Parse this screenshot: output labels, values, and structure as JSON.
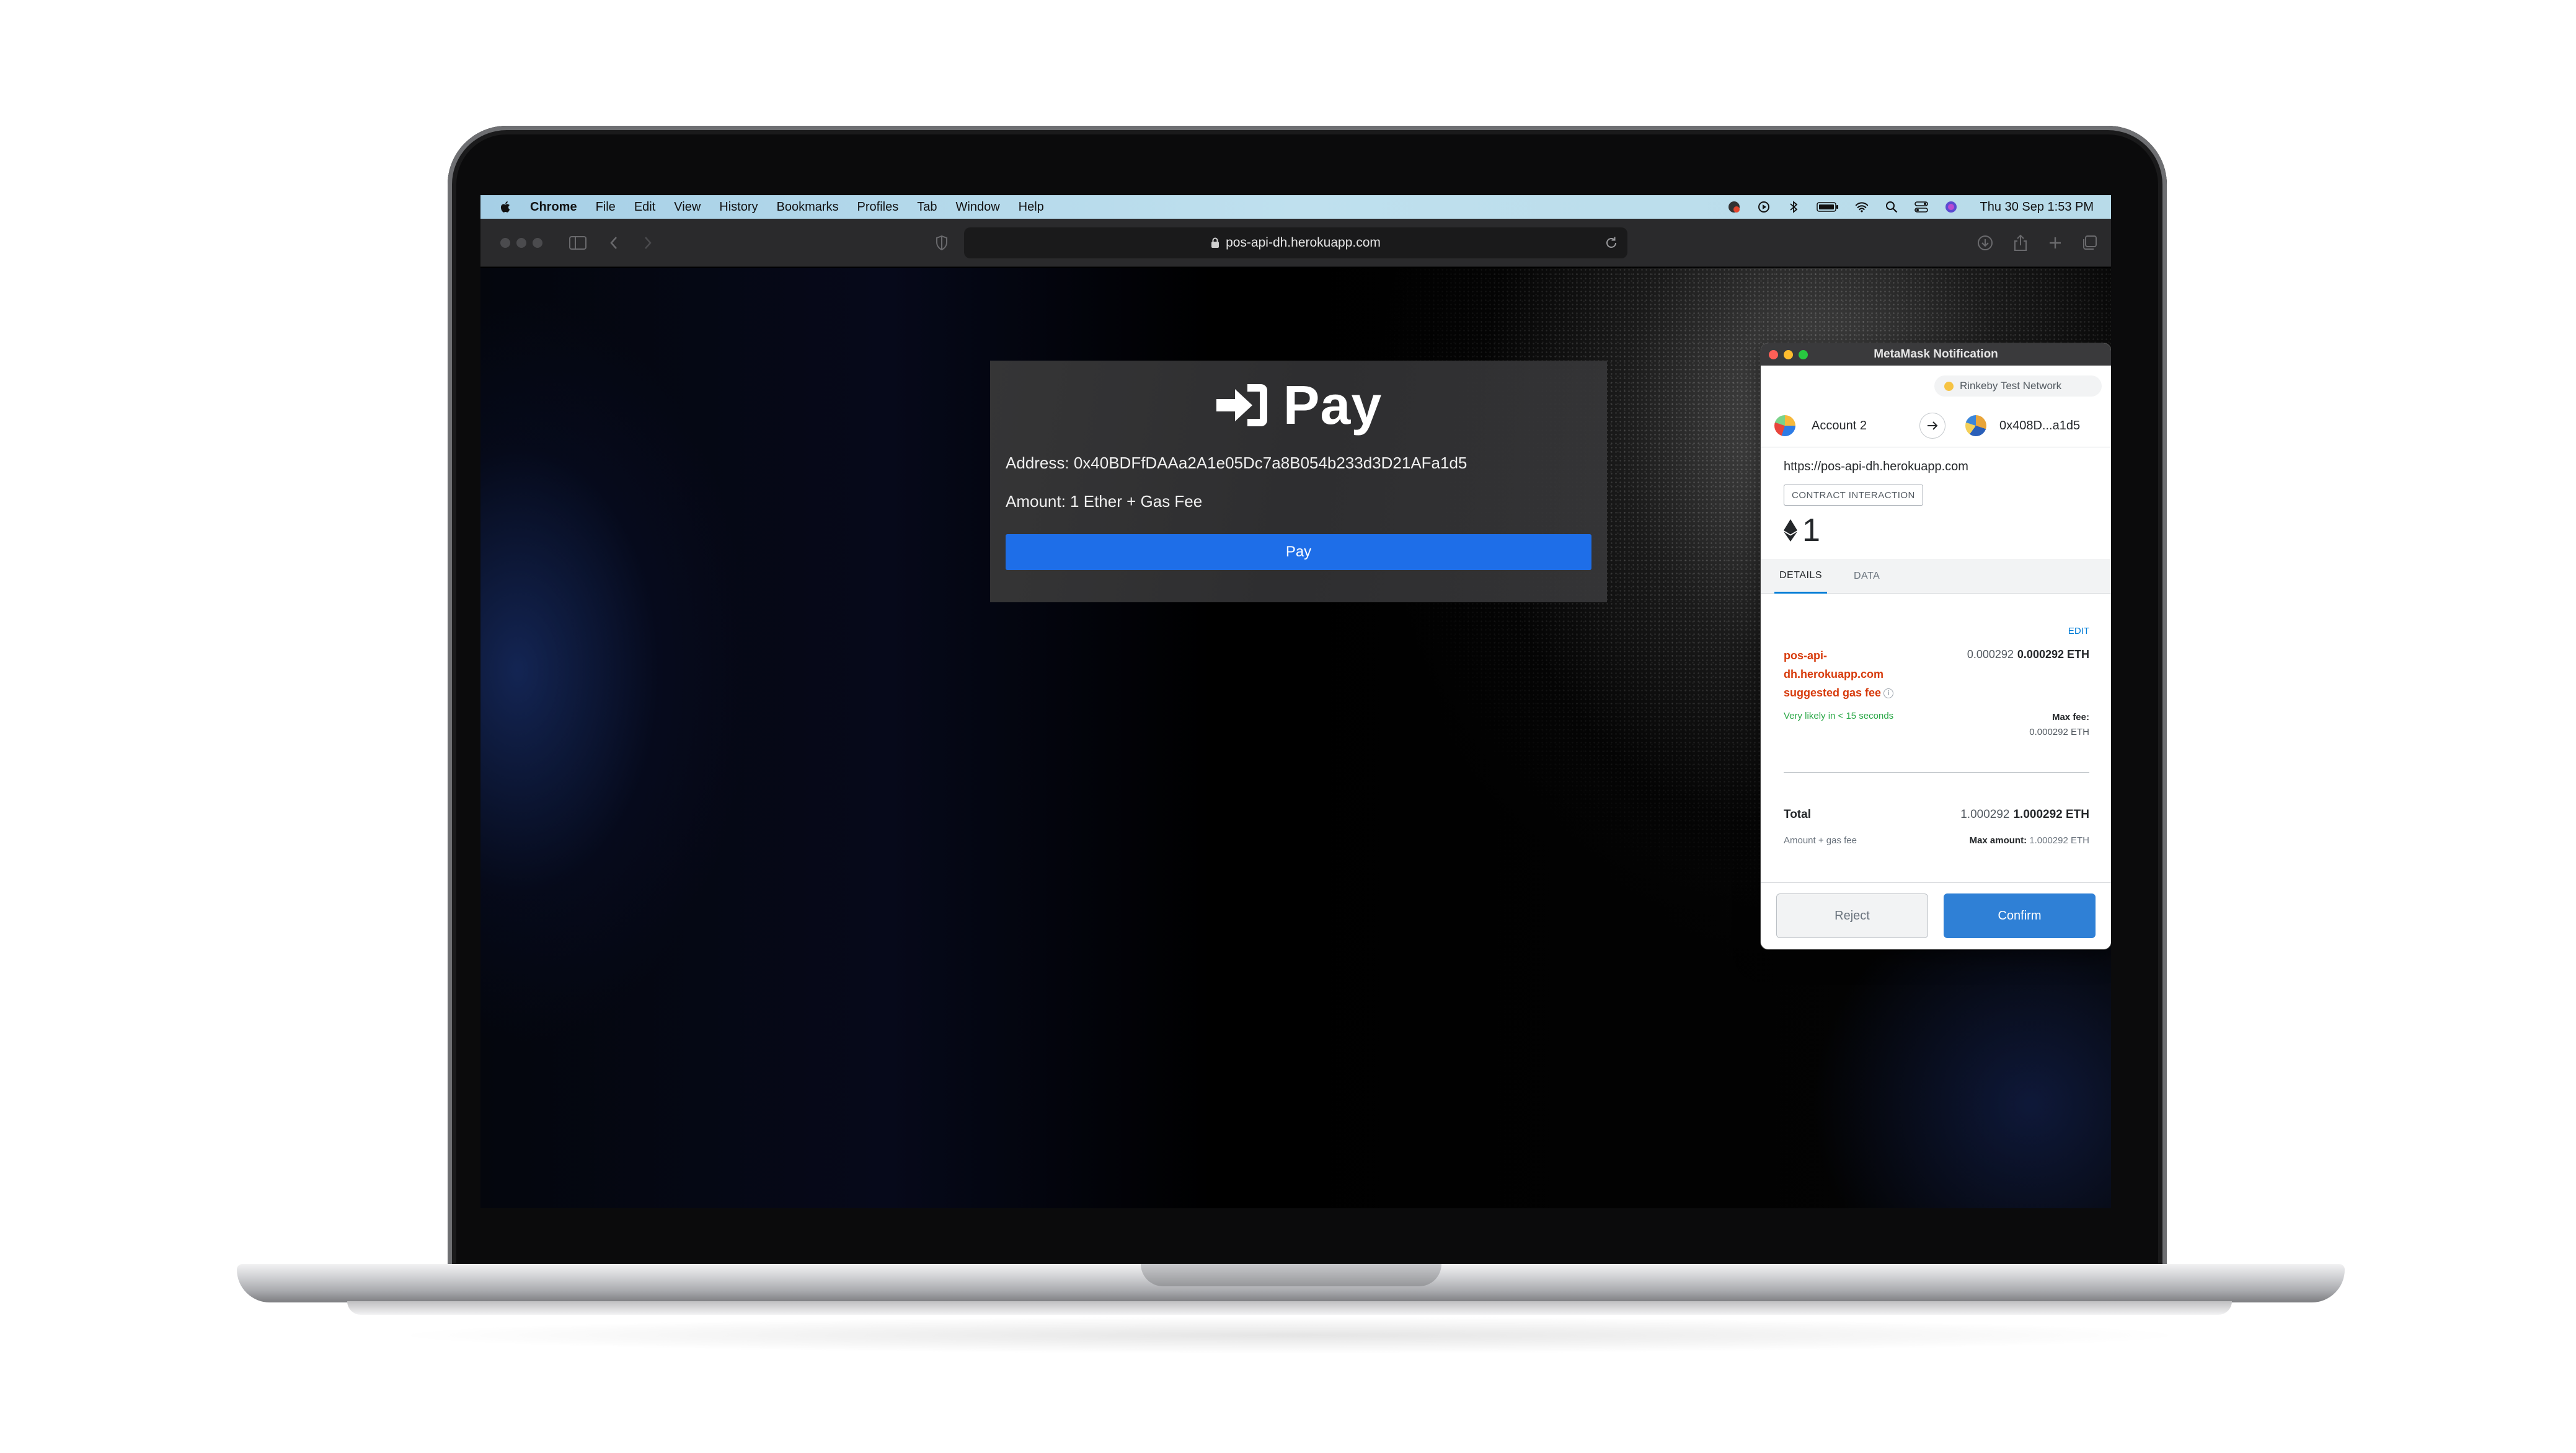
{
  "menubar": {
    "app": "Chrome",
    "items": [
      "File",
      "Edit",
      "View",
      "History",
      "Bookmarks",
      "Profiles",
      "Tab",
      "Window",
      "Help"
    ],
    "clock": "Thu 30 Sep  1:53 PM"
  },
  "browser": {
    "url": "pos-api-dh.herokuapp.com"
  },
  "pay_card": {
    "heading": "Pay",
    "address_line": "Address: 0x40BDFfDAAa2A1e05Dc7a8B054b233d3D21AFa1d5",
    "amount_line": "Amount: 1 Ether + Gas Fee",
    "button_label": "Pay"
  },
  "metamask": {
    "window_title": "MetaMask Notification",
    "network": "Rinkeby Test Network",
    "account_name": "Account 2",
    "recipient_address": "0x408D...a1d5",
    "origin": "https://pos-api-dh.herokuapp.com",
    "tag": "CONTRACT INTERACTION",
    "amount": "1",
    "tabs": [
      "DETAILS",
      "DATA"
    ],
    "edit_label": "EDIT",
    "fee_label": "pos-api-dh.herokuapp.com suggested gas fee",
    "fee_secondary": "0.000292",
    "fee_primary": "0.000292 ETH",
    "likely_text": "Very likely in < 15 seconds",
    "max_fee_label": "Max fee:",
    "max_fee_value": "0.000292 ETH",
    "total_label": "Total",
    "total_secondary": "1.000292",
    "total_primary": "1.000292 ETH",
    "total_sub_label": "Amount + gas fee",
    "max_amount_label": "Max amount:",
    "max_amount_value": "1.000292 ETH",
    "reject_label": "Reject",
    "confirm_label": "Confirm"
  },
  "colors": {
    "pay_button": "#1e6ee8",
    "confirm_button": "#2f80d6",
    "fee_label": "#d73a0b",
    "likely_text": "#28a745"
  }
}
